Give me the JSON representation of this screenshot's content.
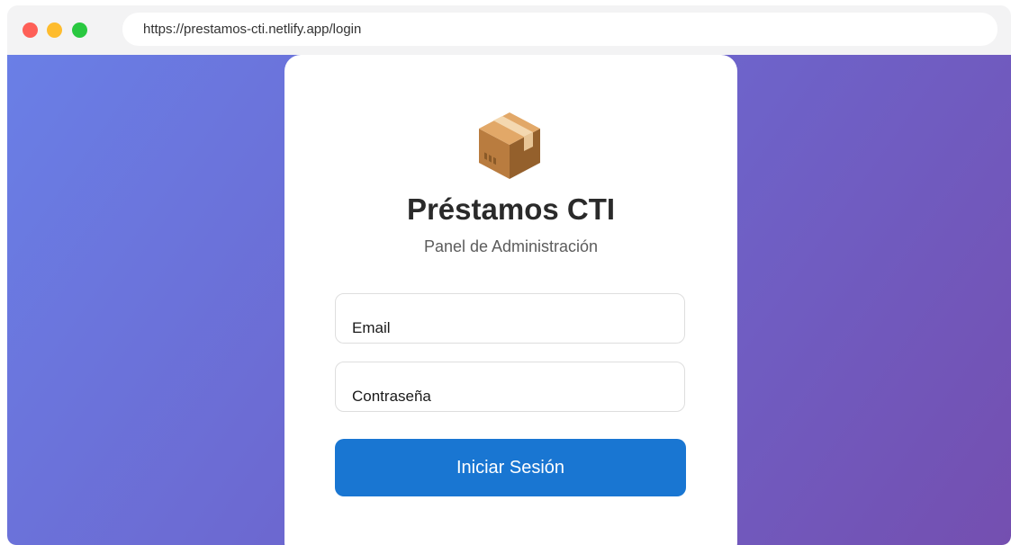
{
  "browser": {
    "url": "https://prestamos-cti.netlify.app/login"
  },
  "login": {
    "logo_icon": "package-box-icon",
    "title": "Préstamos CTI",
    "subtitle": "Panel de Administración",
    "email_placeholder": "Email",
    "password_placeholder": "Contraseña",
    "submit_label": "Iniciar Sesión"
  },
  "colors": {
    "gradient_start": "#6a7fe6",
    "gradient_end": "#744fb0",
    "primary_button": "#1976d2",
    "close_dot": "#fe5f57",
    "minimize_dot": "#febc2e",
    "maximize_dot": "#29c840"
  }
}
